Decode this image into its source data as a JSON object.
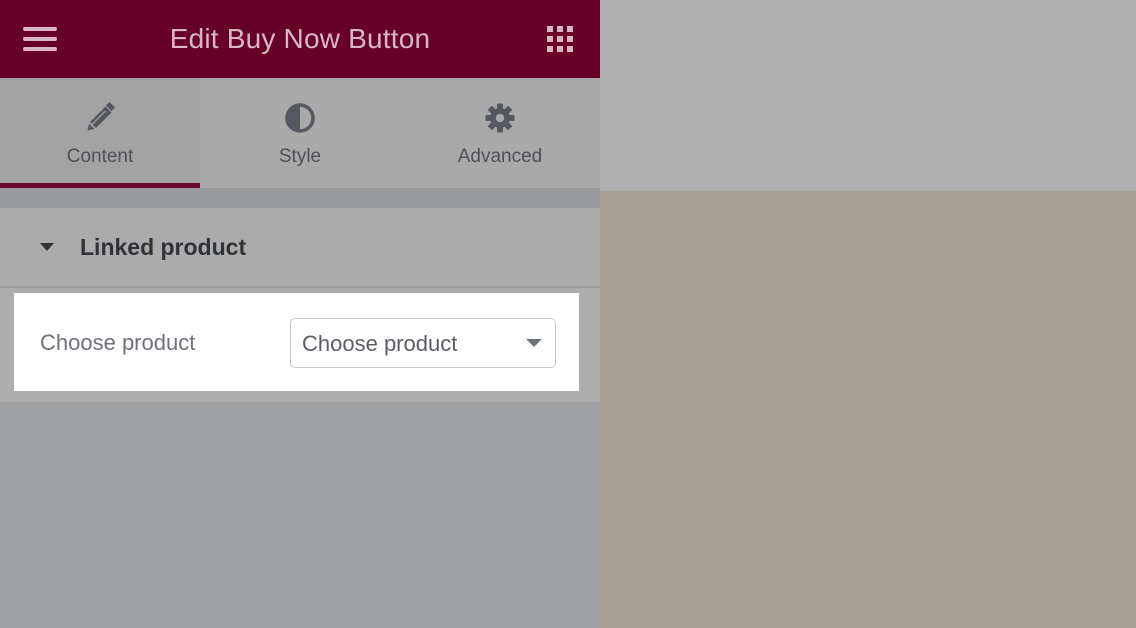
{
  "header": {
    "title": "Edit Buy Now Button",
    "menu_icon": "hamburger-menu-icon",
    "apps_icon": "grid-apps-icon",
    "background_color": "#670027"
  },
  "tabs": [
    {
      "label": "Content",
      "icon": "pencil-icon",
      "active": true
    },
    {
      "label": "Style",
      "icon": "half-circle-contrast-icon",
      "active": false
    },
    {
      "label": "Advanced",
      "icon": "gear-icon",
      "active": false
    }
  ],
  "section": {
    "title": "Linked product",
    "icon": "caret-down-icon",
    "control": {
      "label": "Choose product",
      "select_value": "Choose product",
      "select_icon": "chevron-down-icon"
    }
  },
  "colors": {
    "accent": "#6b0a31",
    "preview_background": "#a6a296"
  }
}
